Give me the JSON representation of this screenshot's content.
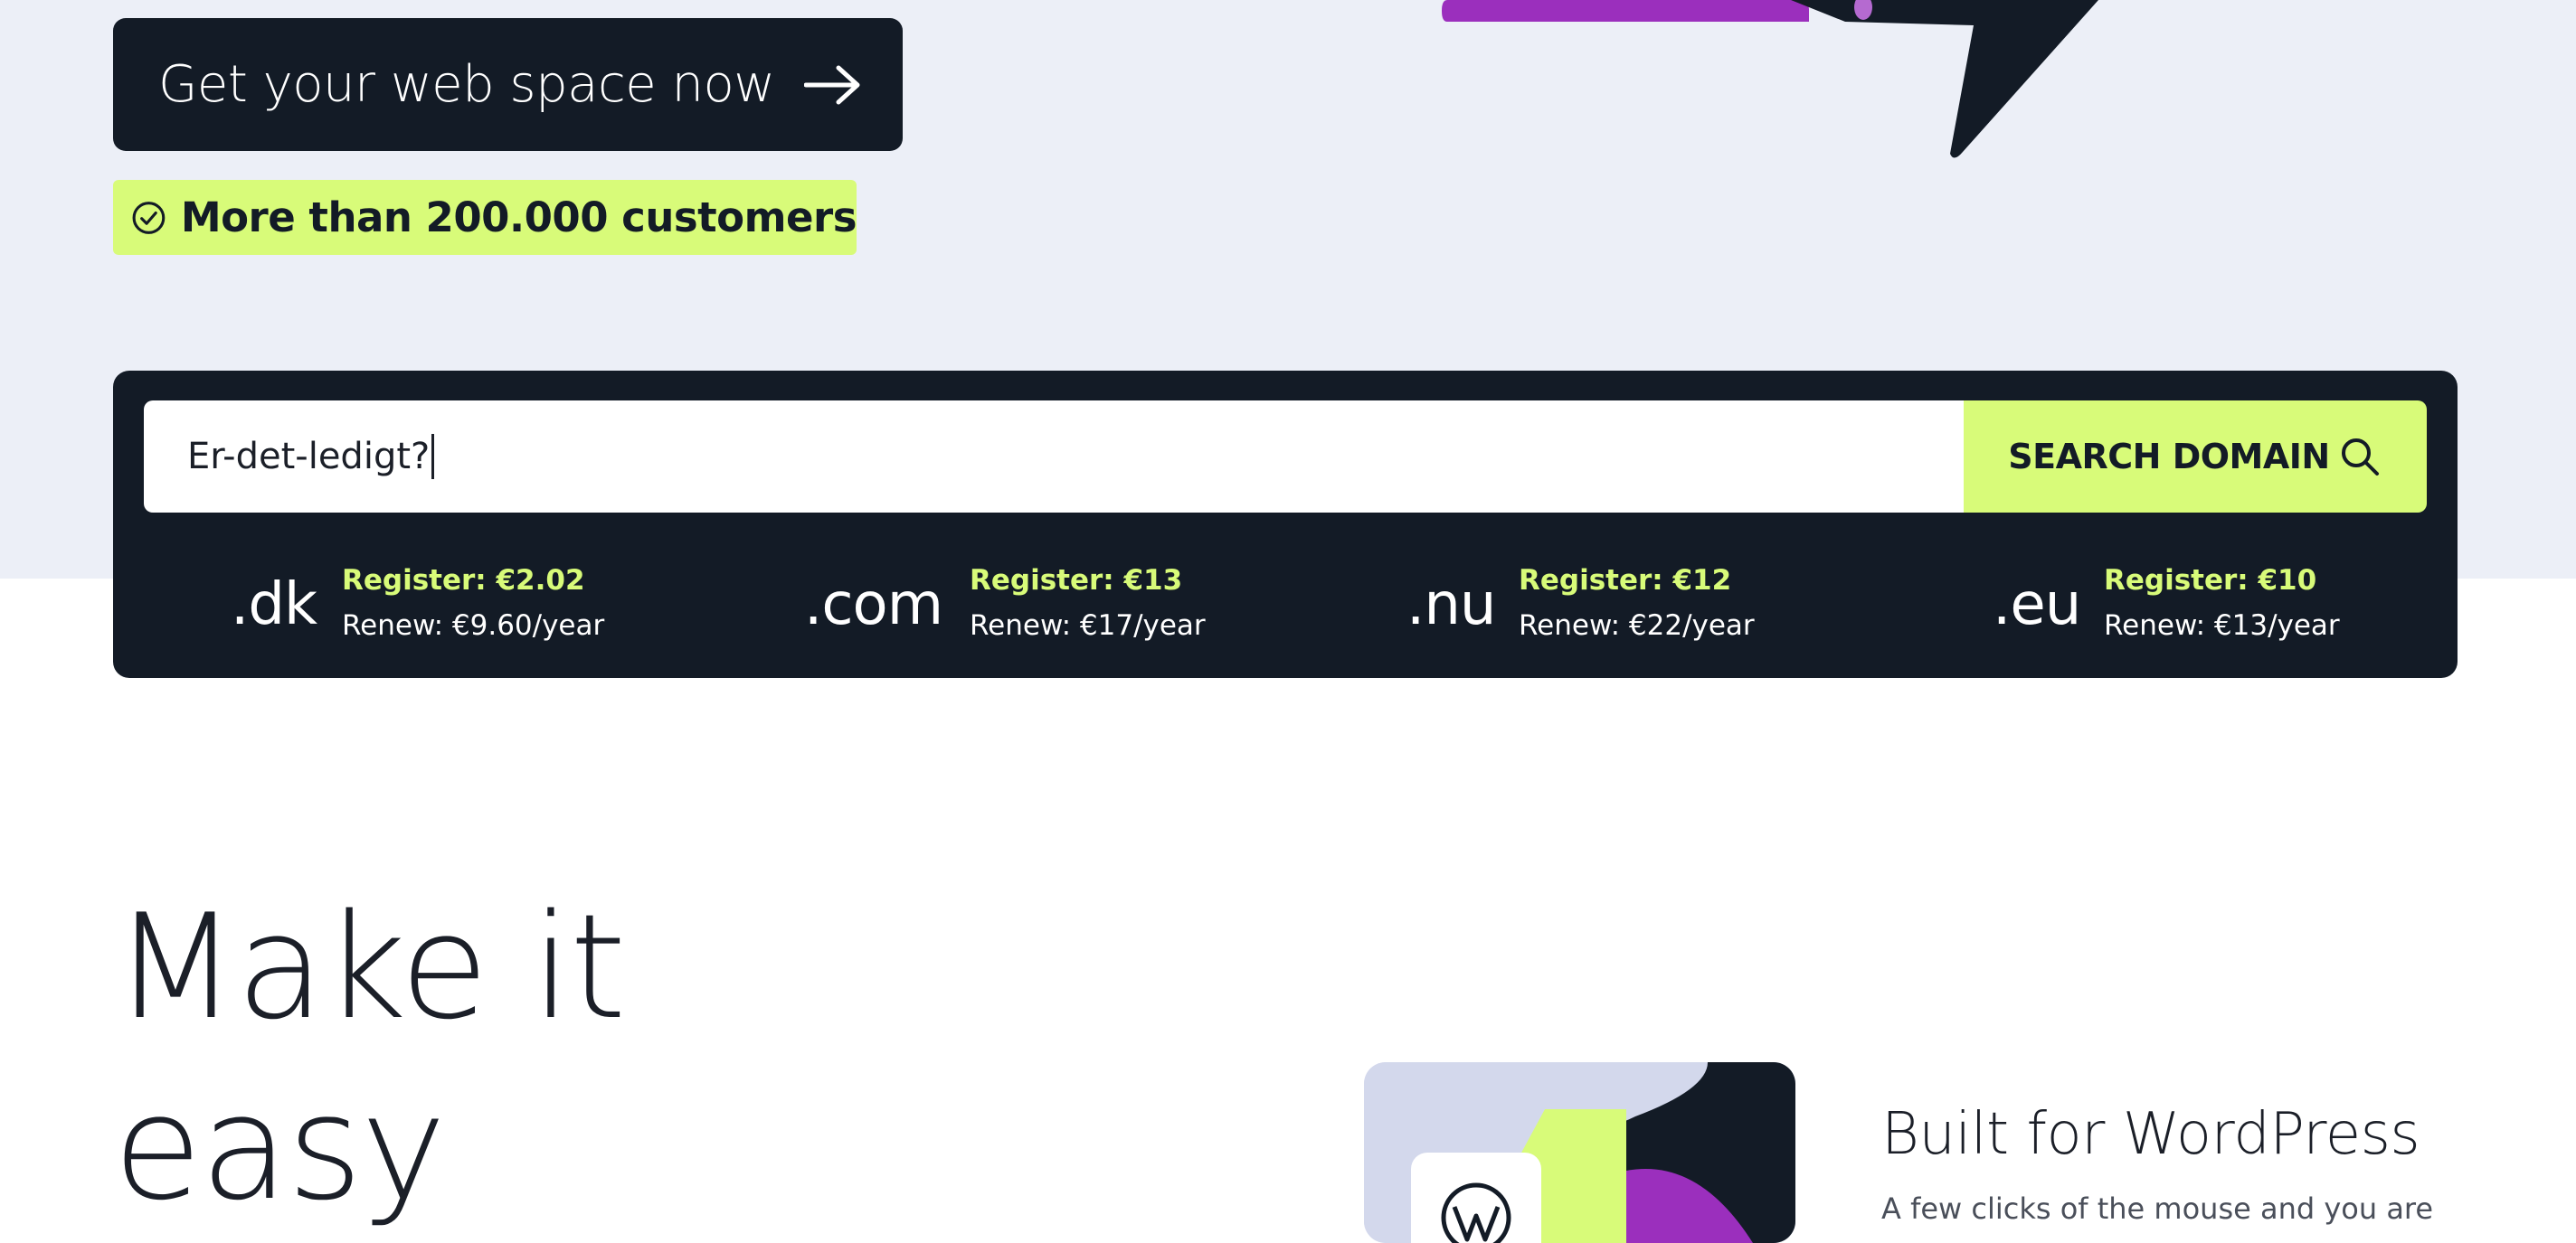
{
  "hero": {
    "cta_label": "Get your web space now",
    "badge_text": "More than 200.000 customers"
  },
  "domain_search": {
    "input_value": "Er-det-ledigt?",
    "button_label": "SEARCH DOMAIN",
    "tlds": [
      {
        "name": ".dk",
        "register": "Register: €2.02",
        "renew": "Renew: €9.60/year"
      },
      {
        "name": ".com",
        "register": "Register: €13",
        "renew": "Renew: €17/year"
      },
      {
        "name": ".nu",
        "register": "Register: €12",
        "renew": "Renew: €22/year"
      },
      {
        "name": ".eu",
        "register": "Register: €10",
        "renew": "Renew: €13/year"
      }
    ]
  },
  "section": {
    "title_line1": "Make it",
    "title_line2": "easy"
  },
  "feature": {
    "title": "Built for WordPress",
    "description": "A few clicks of the mouse and you are"
  },
  "colors": {
    "dark": "#131b26",
    "accent": "#d8fb79",
    "purple": "#9b2fbd",
    "hero_bg": "#eceff7"
  },
  "icons": {
    "cta": "arrow-right-icon",
    "badge": "check-circle-icon",
    "search": "search-icon",
    "wordpress": "wordpress-icon"
  }
}
